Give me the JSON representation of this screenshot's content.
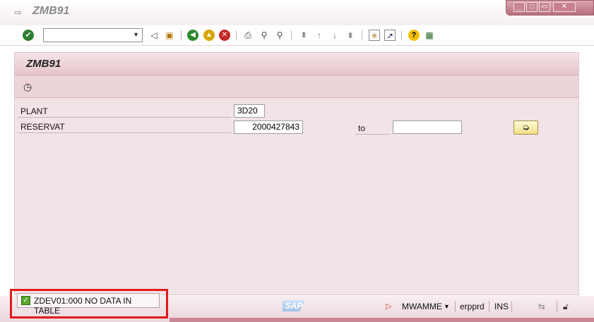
{
  "window": {
    "title": "ZMB91"
  },
  "toolbar": {
    "command_field_value": "",
    "icons": [
      "enter-icon",
      "back-icon",
      "save-icon",
      "back-nav-icon",
      "exit-icon",
      "cancel-icon",
      "print-icon",
      "find-icon",
      "find-next-icon",
      "first-page-icon",
      "previous-page-icon",
      "next-page-icon",
      "last-page-icon",
      "create-session-icon",
      "shortcut-icon",
      "help-icon",
      "customize-layout-icon"
    ]
  },
  "screen": {
    "title": "ZMB91",
    "app_toolbar_icon": "execute-icon"
  },
  "selection": {
    "plant_label": "PLANT",
    "plant_value": "3D20",
    "reservat_label": "RESERVAT",
    "reservat_from": "2000427843",
    "to_label": "to",
    "reservat_to": ""
  },
  "status": {
    "message": "ZDEV01:000 NO DATA IN TABLE",
    "type": "success",
    "logo": "SAP",
    "user": "MWAMME",
    "server": "erpprd",
    "mode": "INS"
  },
  "colors": {
    "accent": "#e01b1b",
    "panel": "#f2e3e7",
    "header": "#e6c4cb"
  }
}
